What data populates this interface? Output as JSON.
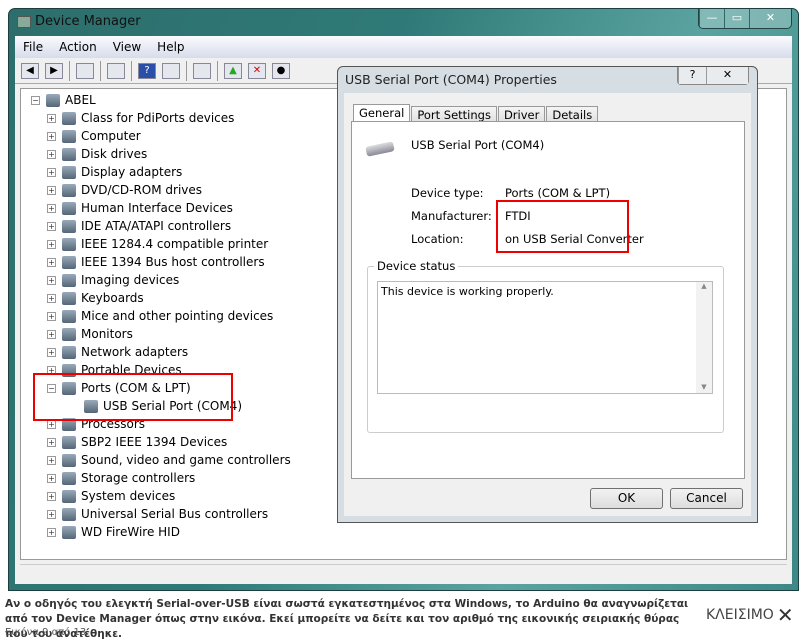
{
  "window": {
    "title": "Device Manager",
    "controls": [
      "—",
      "▭",
      "✕"
    ]
  },
  "menu": [
    "File",
    "Action",
    "View",
    "Help"
  ],
  "toolbar": [
    "back-icon",
    "forward-icon",
    "show-hide-icon",
    "properties-icon",
    "help-icon",
    "action-pane-icon",
    "scan-icon",
    "update-driver-icon",
    "uninstall-icon",
    "disable-icon"
  ],
  "tree": {
    "root": "ABEL",
    "items": [
      "Class for PdiPorts devices",
      "Computer",
      "Disk drives",
      "Display adapters",
      "DVD/CD-ROM drives",
      "Human Interface Devices",
      "IDE ATA/ATAPI controllers",
      "IEEE 1284.4 compatible printer",
      "IEEE 1394 Bus host controllers",
      "Imaging devices",
      "Keyboards",
      "Mice and other pointing devices",
      "Monitors",
      "Network adapters",
      "Portable Devices",
      "Ports (COM & LPT)",
      "USB Serial Port (COM4)",
      "Processors",
      "SBP2 IEEE 1394 Devices",
      "Sound, video and game controllers",
      "Storage controllers",
      "System devices",
      "Universal Serial Bus controllers",
      "WD FireWire HID"
    ]
  },
  "dialog": {
    "title": "USB Serial Port (COM4) Properties",
    "help": "?",
    "close": "✕",
    "tabs": [
      "General",
      "Port Settings",
      "Driver",
      "Details"
    ],
    "device_name": "USB Serial Port (COM4)",
    "fields": [
      {
        "label": "Device type:",
        "value": "Ports (COM & LPT)"
      },
      {
        "label": "Manufacturer:",
        "value": "FTDI"
      },
      {
        "label": "Location:",
        "value": "on USB Serial Converter"
      }
    ],
    "status_group": "Device status",
    "status_text": "This device is working properly.",
    "ok": "OK",
    "cancel": "Cancel"
  },
  "caption": {
    "text": "Αν ο οδηγός του ελεγκτή Serial-over-USB είναι σωστά εγκατεστημένος στα Windows, το Arduino θα αναγνωρίζεται από τον Device Manager όπως στην εικόνα. Εκεί μπορείτε να δείτε και τον αριθμό της εικονικής σειριακής θύρας που του ανατέθηκε.",
    "counter": "Εικόνα 9 από 13",
    "close": "ΚΛΕΙΣΙΜΟ",
    "close_glyph": "✕"
  },
  "colors": {
    "highlight": "#e00000",
    "frame": "#2f7a78"
  }
}
